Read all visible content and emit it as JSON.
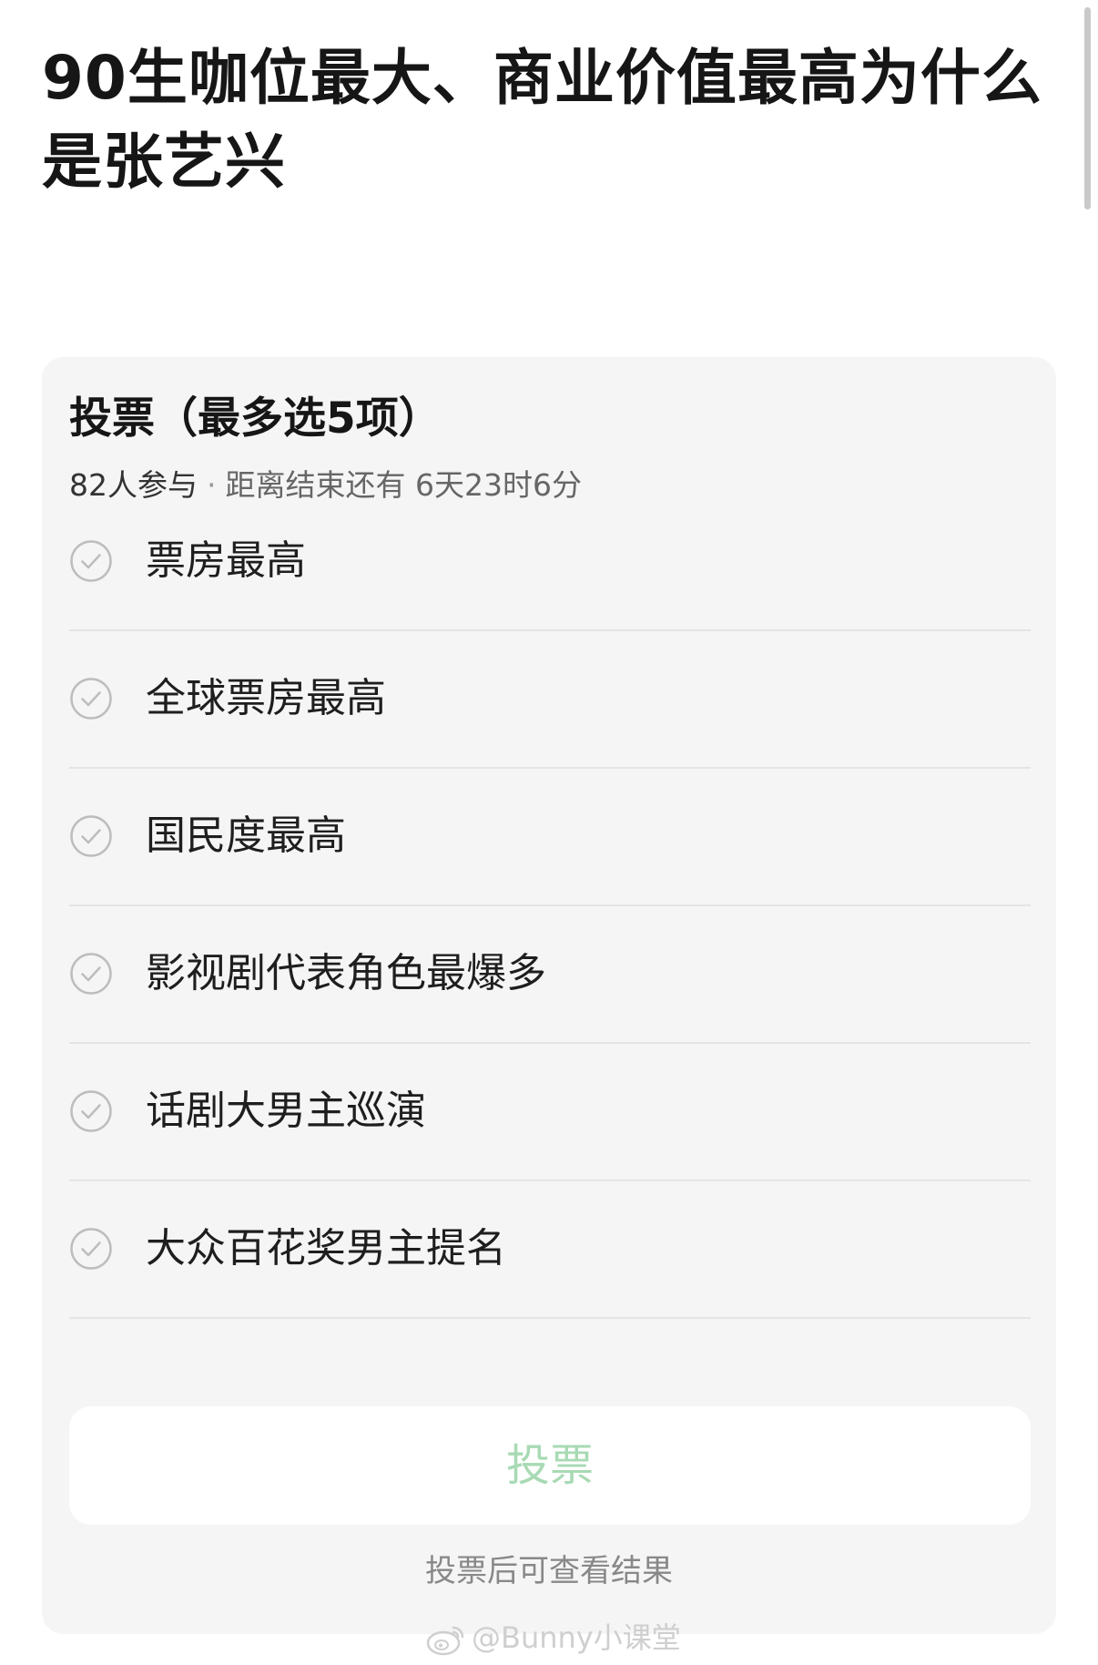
{
  "page": {
    "title": "90生咖位最大、商业价值最高为什么是张艺兴"
  },
  "poll": {
    "title": "投票（最多选5项）",
    "participants": "82人参与",
    "separator": "·",
    "time_remaining": "距离结束还有 6天23时6分",
    "options": [
      {
        "label": "票房最高",
        "icon": "check-circle-icon",
        "selected": false
      },
      {
        "label": "全球票房最高",
        "icon": "check-circle-icon",
        "selected": false
      },
      {
        "label": "国民度最高",
        "icon": "check-circle-icon",
        "selected": false
      },
      {
        "label": "影视剧代表角色最爆多",
        "icon": "check-circle-icon",
        "selected": false
      },
      {
        "label": "话剧大男主巡演",
        "icon": "check-circle-icon",
        "selected": false
      },
      {
        "label": "大众百花奖男主提名",
        "icon": "check-circle-icon",
        "selected": false
      }
    ],
    "vote_button_label": "投票",
    "result_hint": "投票后可查看结果"
  },
  "watermark": {
    "icon": "weibo-icon",
    "text": "@Bunny小课堂"
  },
  "colors": {
    "card_background": "#f5f5f5",
    "vote_button_text": "#a8dab4",
    "divider": "#e4e4e4"
  }
}
